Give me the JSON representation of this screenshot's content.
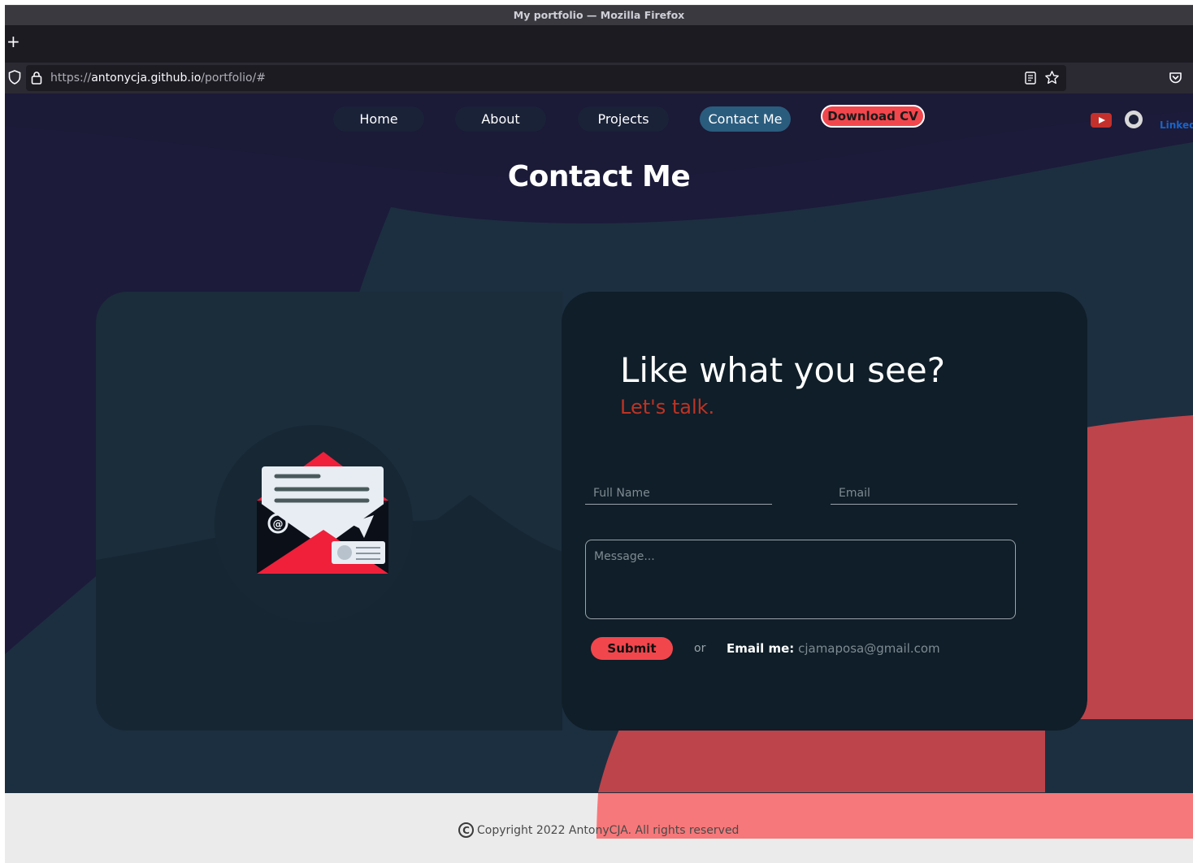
{
  "browser": {
    "window_title": "My portfolio — Mozilla Firefox",
    "new_tab": "+",
    "url_scheme": "https://",
    "url_host": "antonycja.github.io",
    "url_path": "/portfolio/#"
  },
  "nav": {
    "items": [
      {
        "label": "Home",
        "active": false
      },
      {
        "label": "About",
        "active": false
      },
      {
        "label": "Projects",
        "active": false
      },
      {
        "label": "Contact Me",
        "active": true
      }
    ],
    "download_cv": "Download CV",
    "social": {
      "linkedin_label": "Linked"
    }
  },
  "section": {
    "title": "Contact Me"
  },
  "contact": {
    "headline": "Like what you see?",
    "subline": "Let's talk.",
    "full_name_placeholder": "Full Name",
    "email_placeholder": "Email",
    "message_placeholder": "Message...",
    "submit_label": "Submit",
    "or_text": "or",
    "email_me_label": "Email me:",
    "email_address": "cjamaposa@gmail.com"
  },
  "footer": {
    "copyright_symbol": "C",
    "copyright_text": "Copyright 2022 AntonyCJA. All rights reserved"
  },
  "colors": {
    "accent_red": "#f2464d",
    "nav_active": "#2a5c7e",
    "subline_red": "#bf3324",
    "background_navy": "#1c1b3a",
    "background_teal": "#1c2f40"
  }
}
